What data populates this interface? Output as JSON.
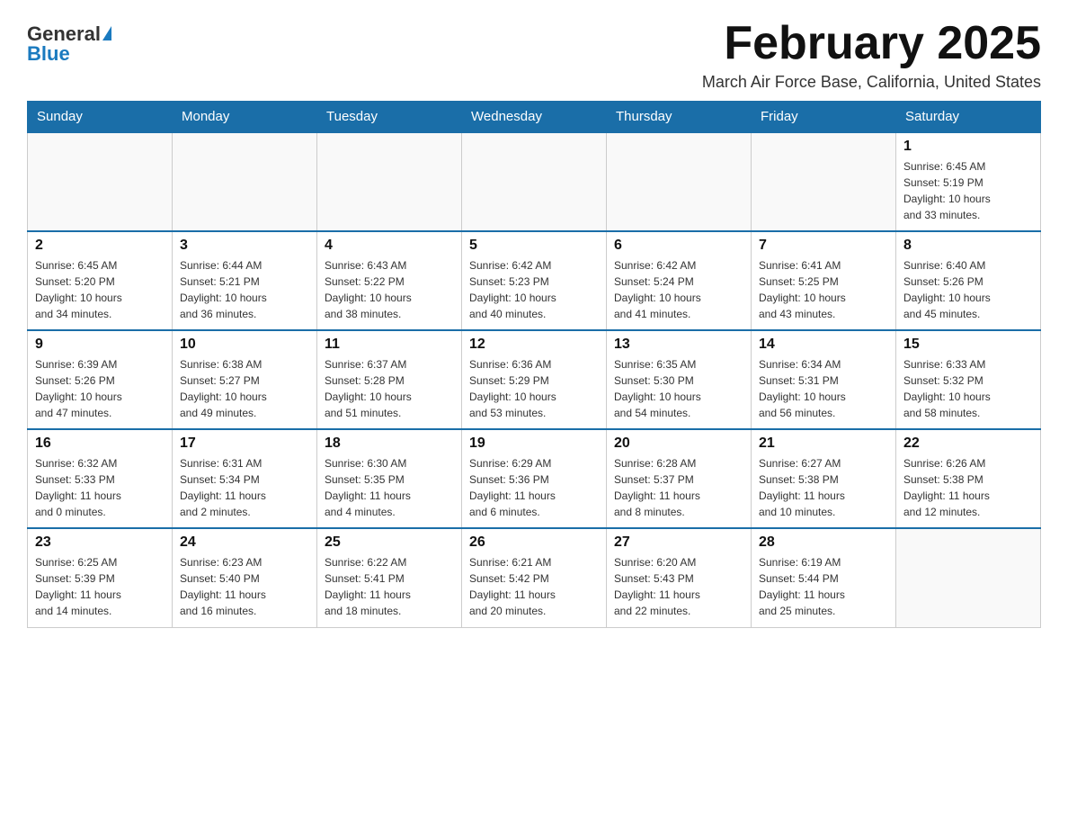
{
  "logo": {
    "general": "General",
    "blue": "Blue"
  },
  "title": {
    "month": "February 2025",
    "location": "March Air Force Base, California, United States"
  },
  "headers": [
    "Sunday",
    "Monday",
    "Tuesday",
    "Wednesday",
    "Thursday",
    "Friday",
    "Saturday"
  ],
  "weeks": [
    [
      {
        "day": "",
        "info": ""
      },
      {
        "day": "",
        "info": ""
      },
      {
        "day": "",
        "info": ""
      },
      {
        "day": "",
        "info": ""
      },
      {
        "day": "",
        "info": ""
      },
      {
        "day": "",
        "info": ""
      },
      {
        "day": "1",
        "info": "Sunrise: 6:45 AM\nSunset: 5:19 PM\nDaylight: 10 hours\nand 33 minutes."
      }
    ],
    [
      {
        "day": "2",
        "info": "Sunrise: 6:45 AM\nSunset: 5:20 PM\nDaylight: 10 hours\nand 34 minutes."
      },
      {
        "day": "3",
        "info": "Sunrise: 6:44 AM\nSunset: 5:21 PM\nDaylight: 10 hours\nand 36 minutes."
      },
      {
        "day": "4",
        "info": "Sunrise: 6:43 AM\nSunset: 5:22 PM\nDaylight: 10 hours\nand 38 minutes."
      },
      {
        "day": "5",
        "info": "Sunrise: 6:42 AM\nSunset: 5:23 PM\nDaylight: 10 hours\nand 40 minutes."
      },
      {
        "day": "6",
        "info": "Sunrise: 6:42 AM\nSunset: 5:24 PM\nDaylight: 10 hours\nand 41 minutes."
      },
      {
        "day": "7",
        "info": "Sunrise: 6:41 AM\nSunset: 5:25 PM\nDaylight: 10 hours\nand 43 minutes."
      },
      {
        "day": "8",
        "info": "Sunrise: 6:40 AM\nSunset: 5:26 PM\nDaylight: 10 hours\nand 45 minutes."
      }
    ],
    [
      {
        "day": "9",
        "info": "Sunrise: 6:39 AM\nSunset: 5:26 PM\nDaylight: 10 hours\nand 47 minutes."
      },
      {
        "day": "10",
        "info": "Sunrise: 6:38 AM\nSunset: 5:27 PM\nDaylight: 10 hours\nand 49 minutes."
      },
      {
        "day": "11",
        "info": "Sunrise: 6:37 AM\nSunset: 5:28 PM\nDaylight: 10 hours\nand 51 minutes."
      },
      {
        "day": "12",
        "info": "Sunrise: 6:36 AM\nSunset: 5:29 PM\nDaylight: 10 hours\nand 53 minutes."
      },
      {
        "day": "13",
        "info": "Sunrise: 6:35 AM\nSunset: 5:30 PM\nDaylight: 10 hours\nand 54 minutes."
      },
      {
        "day": "14",
        "info": "Sunrise: 6:34 AM\nSunset: 5:31 PM\nDaylight: 10 hours\nand 56 minutes."
      },
      {
        "day": "15",
        "info": "Sunrise: 6:33 AM\nSunset: 5:32 PM\nDaylight: 10 hours\nand 58 minutes."
      }
    ],
    [
      {
        "day": "16",
        "info": "Sunrise: 6:32 AM\nSunset: 5:33 PM\nDaylight: 11 hours\nand 0 minutes."
      },
      {
        "day": "17",
        "info": "Sunrise: 6:31 AM\nSunset: 5:34 PM\nDaylight: 11 hours\nand 2 minutes."
      },
      {
        "day": "18",
        "info": "Sunrise: 6:30 AM\nSunset: 5:35 PM\nDaylight: 11 hours\nand 4 minutes."
      },
      {
        "day": "19",
        "info": "Sunrise: 6:29 AM\nSunset: 5:36 PM\nDaylight: 11 hours\nand 6 minutes."
      },
      {
        "day": "20",
        "info": "Sunrise: 6:28 AM\nSunset: 5:37 PM\nDaylight: 11 hours\nand 8 minutes."
      },
      {
        "day": "21",
        "info": "Sunrise: 6:27 AM\nSunset: 5:38 PM\nDaylight: 11 hours\nand 10 minutes."
      },
      {
        "day": "22",
        "info": "Sunrise: 6:26 AM\nSunset: 5:38 PM\nDaylight: 11 hours\nand 12 minutes."
      }
    ],
    [
      {
        "day": "23",
        "info": "Sunrise: 6:25 AM\nSunset: 5:39 PM\nDaylight: 11 hours\nand 14 minutes."
      },
      {
        "day": "24",
        "info": "Sunrise: 6:23 AM\nSunset: 5:40 PM\nDaylight: 11 hours\nand 16 minutes."
      },
      {
        "day": "25",
        "info": "Sunrise: 6:22 AM\nSunset: 5:41 PM\nDaylight: 11 hours\nand 18 minutes."
      },
      {
        "day": "26",
        "info": "Sunrise: 6:21 AM\nSunset: 5:42 PM\nDaylight: 11 hours\nand 20 minutes."
      },
      {
        "day": "27",
        "info": "Sunrise: 6:20 AM\nSunset: 5:43 PM\nDaylight: 11 hours\nand 22 minutes."
      },
      {
        "day": "28",
        "info": "Sunrise: 6:19 AM\nSunset: 5:44 PM\nDaylight: 11 hours\nand 25 minutes."
      },
      {
        "day": "",
        "info": ""
      }
    ]
  ]
}
